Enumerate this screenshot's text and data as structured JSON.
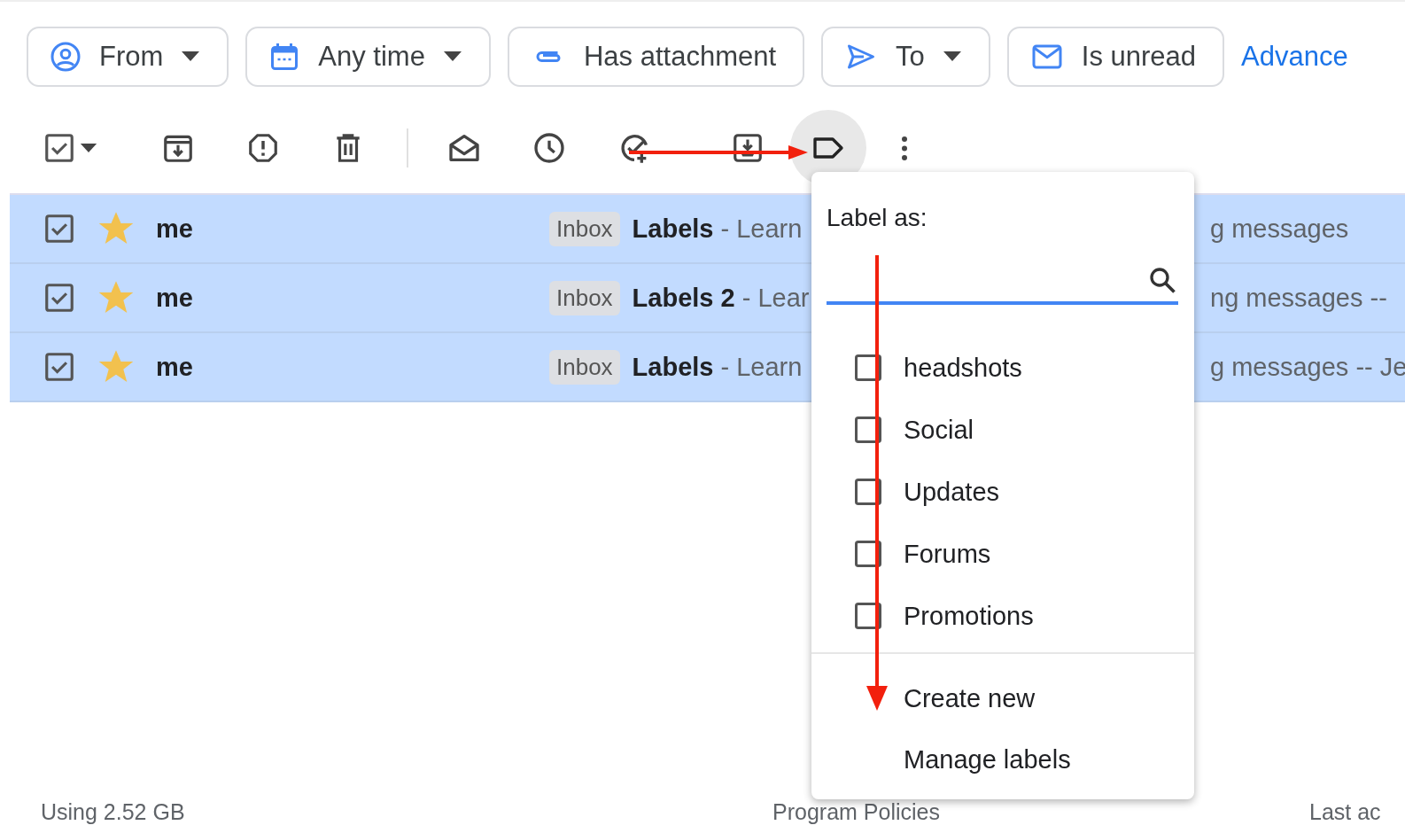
{
  "filters": [
    {
      "label": "From",
      "kind": "person",
      "dropdown": true
    },
    {
      "label": "Any time",
      "kind": "calendar",
      "dropdown": true
    },
    {
      "label": "Has attachment",
      "kind": "clip",
      "dropdown": false
    },
    {
      "label": "To",
      "kind": "send",
      "dropdown": true
    },
    {
      "label": "Is unread",
      "kind": "mail",
      "dropdown": false
    }
  ],
  "advanced": "Advance",
  "toolbar": {
    "select_all_checked": true,
    "label_button_open": true
  },
  "rows": [
    {
      "sender": "me",
      "selected": true,
      "starred": true,
      "badge": "Inbox",
      "subject": "Labels",
      "snippet": "- Learn",
      "snippet_end": "g messages"
    },
    {
      "sender": "me",
      "selected": true,
      "starred": true,
      "badge": "Inbox",
      "subject": "Labels 2",
      "snippet": "- Lear",
      "snippet_end": "ng messages --"
    },
    {
      "sender": "me",
      "selected": true,
      "starred": true,
      "badge": "Inbox",
      "subject": "Labels",
      "snippet": "- Learn",
      "snippet_end": "g messages -- Je"
    }
  ],
  "menu": {
    "title": "Label as:",
    "labels": [
      {
        "name": "headshots",
        "checked": false
      },
      {
        "name": "Social",
        "checked": false
      },
      {
        "name": "Updates",
        "checked": false
      },
      {
        "name": "Forums",
        "checked": false
      },
      {
        "name": "Promotions",
        "checked": false
      }
    ],
    "actions": [
      "Create new",
      "Manage labels"
    ]
  },
  "footer": {
    "storage": "Using 2.52 GB",
    "policies": "Program Policies",
    "activity": "Last ac"
  }
}
